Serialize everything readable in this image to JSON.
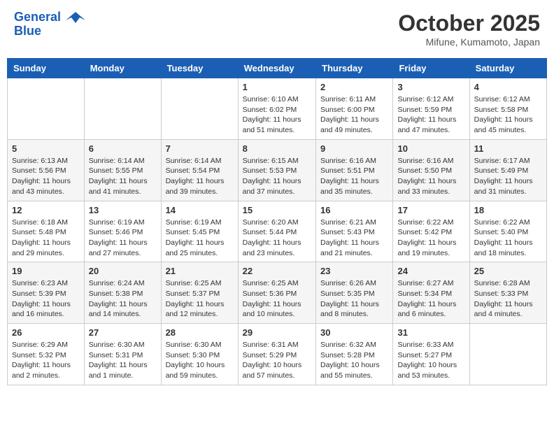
{
  "header": {
    "logo_line1": "General",
    "logo_line2": "Blue",
    "month": "October 2025",
    "location": "Mifune, Kumamoto, Japan"
  },
  "weekdays": [
    "Sunday",
    "Monday",
    "Tuesday",
    "Wednesday",
    "Thursday",
    "Friday",
    "Saturday"
  ],
  "weeks": [
    [
      {
        "day": "",
        "sunrise": "",
        "sunset": "",
        "daylight": ""
      },
      {
        "day": "",
        "sunrise": "",
        "sunset": "",
        "daylight": ""
      },
      {
        "day": "",
        "sunrise": "",
        "sunset": "",
        "daylight": ""
      },
      {
        "day": "1",
        "sunrise": "Sunrise: 6:10 AM",
        "sunset": "Sunset: 6:02 PM",
        "daylight": "Daylight: 11 hours and 51 minutes."
      },
      {
        "day": "2",
        "sunrise": "Sunrise: 6:11 AM",
        "sunset": "Sunset: 6:00 PM",
        "daylight": "Daylight: 11 hours and 49 minutes."
      },
      {
        "day": "3",
        "sunrise": "Sunrise: 6:12 AM",
        "sunset": "Sunset: 5:59 PM",
        "daylight": "Daylight: 11 hours and 47 minutes."
      },
      {
        "day": "4",
        "sunrise": "Sunrise: 6:12 AM",
        "sunset": "Sunset: 5:58 PM",
        "daylight": "Daylight: 11 hours and 45 minutes."
      }
    ],
    [
      {
        "day": "5",
        "sunrise": "Sunrise: 6:13 AM",
        "sunset": "Sunset: 5:56 PM",
        "daylight": "Daylight: 11 hours and 43 minutes."
      },
      {
        "day": "6",
        "sunrise": "Sunrise: 6:14 AM",
        "sunset": "Sunset: 5:55 PM",
        "daylight": "Daylight: 11 hours and 41 minutes."
      },
      {
        "day": "7",
        "sunrise": "Sunrise: 6:14 AM",
        "sunset": "Sunset: 5:54 PM",
        "daylight": "Daylight: 11 hours and 39 minutes."
      },
      {
        "day": "8",
        "sunrise": "Sunrise: 6:15 AM",
        "sunset": "Sunset: 5:53 PM",
        "daylight": "Daylight: 11 hours and 37 minutes."
      },
      {
        "day": "9",
        "sunrise": "Sunrise: 6:16 AM",
        "sunset": "Sunset: 5:51 PM",
        "daylight": "Daylight: 11 hours and 35 minutes."
      },
      {
        "day": "10",
        "sunrise": "Sunrise: 6:16 AM",
        "sunset": "Sunset: 5:50 PM",
        "daylight": "Daylight: 11 hours and 33 minutes."
      },
      {
        "day": "11",
        "sunrise": "Sunrise: 6:17 AM",
        "sunset": "Sunset: 5:49 PM",
        "daylight": "Daylight: 11 hours and 31 minutes."
      }
    ],
    [
      {
        "day": "12",
        "sunrise": "Sunrise: 6:18 AM",
        "sunset": "Sunset: 5:48 PM",
        "daylight": "Daylight: 11 hours and 29 minutes."
      },
      {
        "day": "13",
        "sunrise": "Sunrise: 6:19 AM",
        "sunset": "Sunset: 5:46 PM",
        "daylight": "Daylight: 11 hours and 27 minutes."
      },
      {
        "day": "14",
        "sunrise": "Sunrise: 6:19 AM",
        "sunset": "Sunset: 5:45 PM",
        "daylight": "Daylight: 11 hours and 25 minutes."
      },
      {
        "day": "15",
        "sunrise": "Sunrise: 6:20 AM",
        "sunset": "Sunset: 5:44 PM",
        "daylight": "Daylight: 11 hours and 23 minutes."
      },
      {
        "day": "16",
        "sunrise": "Sunrise: 6:21 AM",
        "sunset": "Sunset: 5:43 PM",
        "daylight": "Daylight: 11 hours and 21 minutes."
      },
      {
        "day": "17",
        "sunrise": "Sunrise: 6:22 AM",
        "sunset": "Sunset: 5:42 PM",
        "daylight": "Daylight: 11 hours and 19 minutes."
      },
      {
        "day": "18",
        "sunrise": "Sunrise: 6:22 AM",
        "sunset": "Sunset: 5:40 PM",
        "daylight": "Daylight: 11 hours and 18 minutes."
      }
    ],
    [
      {
        "day": "19",
        "sunrise": "Sunrise: 6:23 AM",
        "sunset": "Sunset: 5:39 PM",
        "daylight": "Daylight: 11 hours and 16 minutes."
      },
      {
        "day": "20",
        "sunrise": "Sunrise: 6:24 AM",
        "sunset": "Sunset: 5:38 PM",
        "daylight": "Daylight: 11 hours and 14 minutes."
      },
      {
        "day": "21",
        "sunrise": "Sunrise: 6:25 AM",
        "sunset": "Sunset: 5:37 PM",
        "daylight": "Daylight: 11 hours and 12 minutes."
      },
      {
        "day": "22",
        "sunrise": "Sunrise: 6:25 AM",
        "sunset": "Sunset: 5:36 PM",
        "daylight": "Daylight: 11 hours and 10 minutes."
      },
      {
        "day": "23",
        "sunrise": "Sunrise: 6:26 AM",
        "sunset": "Sunset: 5:35 PM",
        "daylight": "Daylight: 11 hours and 8 minutes."
      },
      {
        "day": "24",
        "sunrise": "Sunrise: 6:27 AM",
        "sunset": "Sunset: 5:34 PM",
        "daylight": "Daylight: 11 hours and 6 minutes."
      },
      {
        "day": "25",
        "sunrise": "Sunrise: 6:28 AM",
        "sunset": "Sunset: 5:33 PM",
        "daylight": "Daylight: 11 hours and 4 minutes."
      }
    ],
    [
      {
        "day": "26",
        "sunrise": "Sunrise: 6:29 AM",
        "sunset": "Sunset: 5:32 PM",
        "daylight": "Daylight: 11 hours and 2 minutes."
      },
      {
        "day": "27",
        "sunrise": "Sunrise: 6:30 AM",
        "sunset": "Sunset: 5:31 PM",
        "daylight": "Daylight: 11 hours and 1 minute."
      },
      {
        "day": "28",
        "sunrise": "Sunrise: 6:30 AM",
        "sunset": "Sunset: 5:30 PM",
        "daylight": "Daylight: 10 hours and 59 minutes."
      },
      {
        "day": "29",
        "sunrise": "Sunrise: 6:31 AM",
        "sunset": "Sunset: 5:29 PM",
        "daylight": "Daylight: 10 hours and 57 minutes."
      },
      {
        "day": "30",
        "sunrise": "Sunrise: 6:32 AM",
        "sunset": "Sunset: 5:28 PM",
        "daylight": "Daylight: 10 hours and 55 minutes."
      },
      {
        "day": "31",
        "sunrise": "Sunrise: 6:33 AM",
        "sunset": "Sunset: 5:27 PM",
        "daylight": "Daylight: 10 hours and 53 minutes."
      },
      {
        "day": "",
        "sunrise": "",
        "sunset": "",
        "daylight": ""
      }
    ]
  ]
}
